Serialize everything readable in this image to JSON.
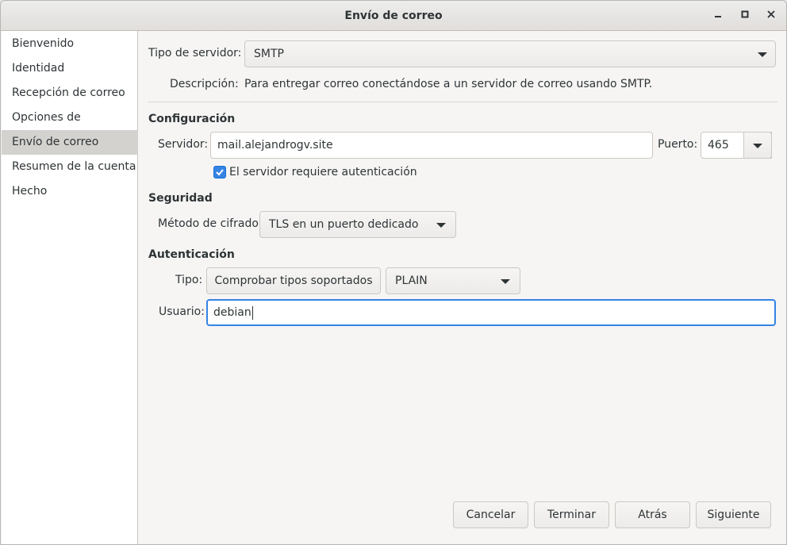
{
  "window": {
    "title": "Envío de correo"
  },
  "titlebar": {
    "minimize_icon": "minimize-icon",
    "maximize_icon": "maximize-icon",
    "close_icon": "close-icon"
  },
  "sidebar": {
    "items": [
      {
        "label": "Bienvenido"
      },
      {
        "label": "Identidad"
      },
      {
        "label": "Recepción de correo"
      },
      {
        "label": "Opciones de recepción"
      },
      {
        "label": "Envío de correo",
        "active": true
      },
      {
        "label": "Resumen de la cuenta"
      },
      {
        "label": "Hecho"
      }
    ]
  },
  "server_type": {
    "label": "Tipo de servidor:",
    "value": "SMTP"
  },
  "description": {
    "label": "Descripción:",
    "text": "Para entregar correo conectándose a un servidor de correo usando SMTP."
  },
  "configuration": {
    "heading": "Configuración",
    "server_label": "Servidor:",
    "server_value": "mail.alejandrogv.site",
    "port_label": "Puerto:",
    "port_value": "465",
    "auth_required_label": "El servidor requiere autenticación",
    "auth_required_checked": true
  },
  "security": {
    "heading": "Seguridad",
    "encryption_label": "Método de cifrado:",
    "encryption_value": "TLS en un puerto dedicado"
  },
  "authentication": {
    "heading": "Autenticación",
    "type_label": "Tipo:",
    "check_button": "Comprobar tipos soportados",
    "type_value": "PLAIN",
    "user_label": "Usuario:",
    "user_value": "debian"
  },
  "footer": {
    "cancel": "Cancelar",
    "finish": "Terminar",
    "back": "Atrás",
    "next": "Siguiente"
  },
  "colors": {
    "accent": "#3584e4",
    "sidebar_active": "#d4d2cf"
  }
}
